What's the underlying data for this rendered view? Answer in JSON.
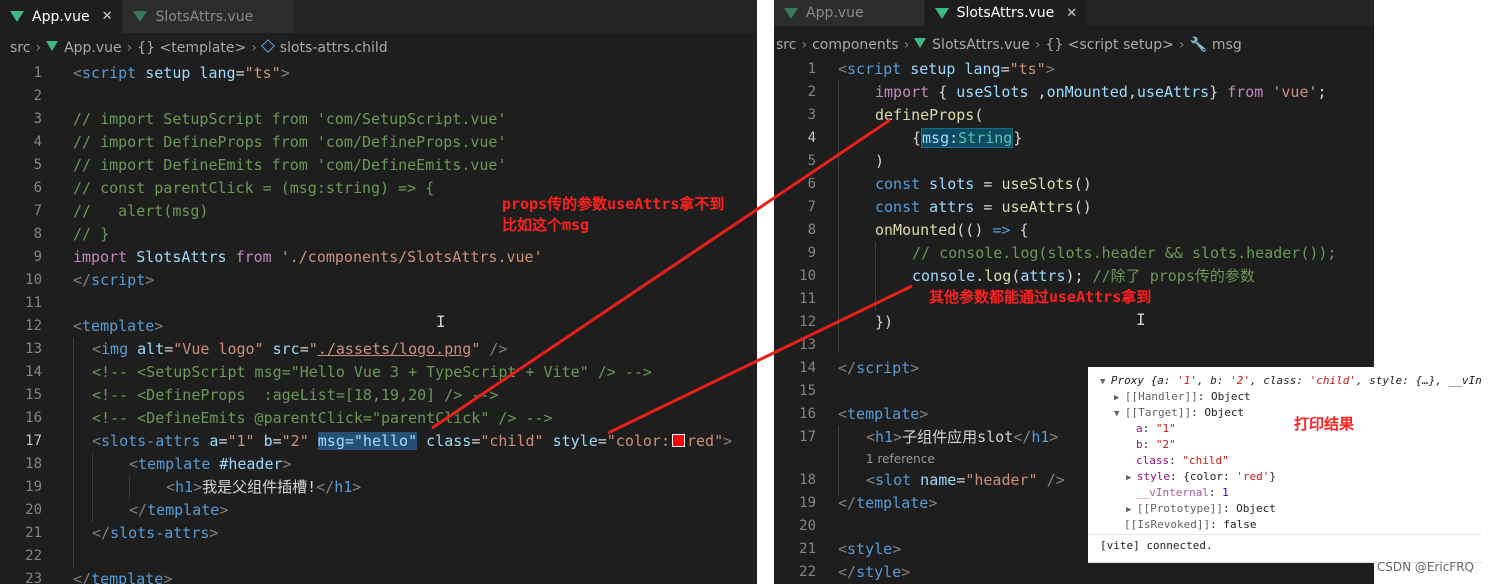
{
  "left_editor": {
    "tabs": [
      {
        "label": "App.vue",
        "close": "✕"
      },
      {
        "label": "SlotsAttrs.vue"
      }
    ],
    "breadcrumb": [
      "src",
      "App.vue",
      "{} <template>",
      "slots-attrs.child"
    ],
    "lines": [
      {
        "n": "1"
      },
      {
        "n": "2"
      },
      {
        "n": "3"
      },
      {
        "n": "4"
      },
      {
        "n": "5"
      },
      {
        "n": "6"
      },
      {
        "n": "7"
      },
      {
        "n": "8"
      },
      {
        "n": "9"
      },
      {
        "n": "10"
      },
      {
        "n": "11"
      },
      {
        "n": "12"
      },
      {
        "n": "13"
      },
      {
        "n": "14"
      },
      {
        "n": "15"
      },
      {
        "n": "16"
      },
      {
        "n": "17"
      },
      {
        "n": "18"
      },
      {
        "n": "19"
      },
      {
        "n": "20"
      },
      {
        "n": "21"
      },
      {
        "n": "22"
      },
      {
        "n": "23"
      }
    ],
    "code": {
      "l1": [
        "<",
        "script",
        " setup",
        " lang",
        "=",
        "\"ts\"",
        ">"
      ],
      "l3": "// import SetupScript from 'com/SetupScript.vue'",
      "l4": "// import DefineProps from 'com/DefineProps.vue'",
      "l5": "// import DefineEmits from 'com/DefineEmits.vue'",
      "l6": "// const parentClick = (msg:string) => {",
      "l7": "//   alert(msg)",
      "l8": "// }",
      "l9": [
        "import",
        " SlotsAttrs ",
        "from",
        " './components/SlotsAttrs.vue'"
      ],
      "l10": [
        "</",
        "script",
        ">"
      ],
      "l12": [
        "<",
        "template",
        ">"
      ],
      "l13": [
        "<",
        "img",
        " alt",
        "=",
        "\"Vue logo\"",
        " src",
        "=",
        "\"",
        "./assets/logo.png",
        "\"",
        " />"
      ],
      "l14": "<!-- <SetupScript msg=\"Hello Vue 3 + TypeScript + Vite\" /> -->",
      "l15": "<!-- <DefineProps  :ageList=[18,19,20] /> -->",
      "l16": "<!-- <DefineEmits @parentClick=\"parentClick\" /> -->",
      "l17": [
        "<",
        "slots-attrs",
        " a",
        "=",
        "\"1\"",
        " b",
        "=",
        "\"2\"",
        " ",
        "msg=\"hello\"",
        " class",
        "=",
        "\"child\"",
        " style",
        "=",
        "\"color:",
        "red\"",
        ">"
      ],
      "l18": [
        "<",
        "template",
        " #header",
        ">"
      ],
      "l19": [
        "<",
        "h1",
        ">",
        "我是父组件插槽!",
        "</",
        "h1",
        ">"
      ],
      "l20": [
        "</",
        "template",
        ">"
      ],
      "l21": [
        "</",
        "slots-attrs",
        ">"
      ],
      "l23": [
        "</",
        "template",
        ">"
      ]
    },
    "annotation": [
      "props传的参数useAttrs拿不到",
      "比如这个msg"
    ]
  },
  "right_editor": {
    "tabs": [
      {
        "label": "App.vue"
      },
      {
        "label": "SlotsAttrs.vue",
        "close": "✕"
      }
    ],
    "breadcrumb": [
      "src",
      "components",
      "SlotsAttrs.vue",
      "{} <script setup>",
      "msg"
    ],
    "lines": [
      {
        "n": "1"
      },
      {
        "n": "2"
      },
      {
        "n": "3"
      },
      {
        "n": "4"
      },
      {
        "n": "5"
      },
      {
        "n": "6"
      },
      {
        "n": "7"
      },
      {
        "n": "8"
      },
      {
        "n": "9"
      },
      {
        "n": "10"
      },
      {
        "n": "11"
      },
      {
        "n": "12"
      },
      {
        "n": "13"
      },
      {
        "n": "14"
      },
      {
        "n": "15"
      },
      {
        "n": "16"
      },
      {
        "n": "17"
      },
      {
        "n": "18"
      },
      {
        "n": "19"
      },
      {
        "n": "20"
      },
      {
        "n": "21"
      },
      {
        "n": "22"
      }
    ],
    "code": {
      "l1": [
        "<",
        "script",
        " setup",
        " lang",
        "=",
        "\"ts\"",
        ">"
      ],
      "l2": [
        "import",
        " { ",
        "useSlots",
        " ,",
        "onMounted",
        ",",
        "useAttrs",
        "} ",
        "from",
        " 'vue'",
        ";"
      ],
      "l3": [
        "defineProps",
        "("
      ],
      "l4": [
        "{",
        "msg",
        ":",
        "String",
        "}"
      ],
      "l5": ")",
      "l6": [
        "const",
        " slots ",
        "= ",
        "useSlots",
        "()"
      ],
      "l7": [
        "const",
        " attrs ",
        "= ",
        "useAttrs",
        "()"
      ],
      "l8": [
        "onMounted",
        "(() ",
        "=>",
        " {"
      ],
      "l9": "// console.log(slots.header && slots.header());",
      "l10": [
        "console",
        ".",
        "log",
        "(",
        "attrs",
        "); ",
        "//除了 props传的参数"
      ],
      "l12": "})",
      "l14": [
        "</",
        "script",
        ">"
      ],
      "l16": [
        "<",
        "template",
        ">"
      ],
      "l17": [
        "<",
        "h1",
        ">",
        "子组件应用slot",
        "</",
        "h1",
        ">"
      ],
      "codelens": "1 reference",
      "l18": [
        "<",
        "slot",
        " name",
        "=",
        "\"header\"",
        " />"
      ],
      "l19": [
        "</",
        "template",
        ">"
      ],
      "l21": [
        "<",
        "style",
        ">"
      ],
      "l22": [
        "</",
        "style",
        ">"
      ]
    },
    "annotation": "其他参数都能通过useAttrs拿到"
  },
  "console": {
    "proxy_line": [
      "Proxy ",
      "{a: ",
      "'1'",
      ", b: ",
      "'2'",
      ", class: ",
      "'child'",
      ", style: {…}, __vIn"
    ],
    "handler": [
      "[[Handler]]",
      ": Object"
    ],
    "target": [
      "[[Target]]",
      ": Object"
    ],
    "a": [
      "a",
      ": ",
      "\"1\""
    ],
    "b": [
      "b",
      ": ",
      "\"2\""
    ],
    "class": [
      "class",
      ": ",
      "\"child\""
    ],
    "style": [
      "style",
      ": {color: ",
      "'red'",
      "}"
    ],
    "vinternal": [
      "__vInternal",
      ": ",
      "1"
    ],
    "prototype": [
      "[[Prototype]]",
      ": Object"
    ],
    "isrevoked": [
      "[[IsRevoked]]",
      ": false"
    ],
    "vite": "[vite] connected.",
    "result_label": "打印结果"
  },
  "watermark": "CSDN @EricFRQ",
  "colors": {
    "annotation": "#ff2020",
    "arrow": "#e8201a",
    "editor_bg": "#1e1e1e",
    "vue_green": "#41b883"
  }
}
